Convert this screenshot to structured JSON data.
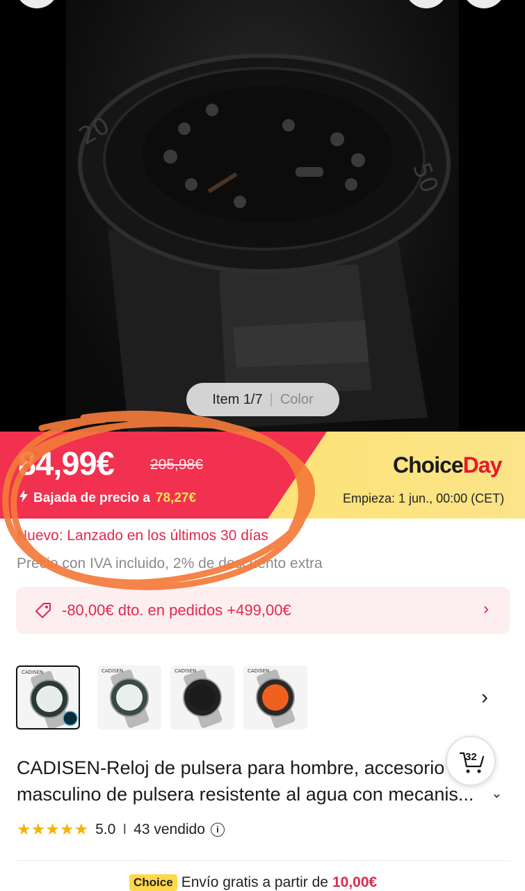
{
  "gallery": {
    "pager_index": "Item 1/7",
    "pager_separator": "|",
    "pager_color": "Color"
  },
  "price": {
    "current": "84,99€",
    "original": "205,98€",
    "drop_label": "Bajada de precio a",
    "drop_value": "78,27€"
  },
  "promo": {
    "logo_part1": "Choice",
    "logo_part2": "Day",
    "start_text": "Empieza:  1 jun., 00:00 (CET)"
  },
  "notes": {
    "new_launch": "Nuevo: Lanzado en los últimos 30 días",
    "vat": "Precio con IVA incluido, 2% de descuento extra"
  },
  "coupon": {
    "text": "-80,00€ dto. en pedidos +499,00€"
  },
  "thumbnails": [
    {
      "brand": "CADISEN",
      "dial": "#e7ecea",
      "bezel": "#2b3a33"
    },
    {
      "brand": "CADISEN",
      "dial": "#e9efec",
      "bezel": "#3a4a44"
    },
    {
      "brand": "CADISEN",
      "dial": "#1b1b1b",
      "bezel": "#222222"
    },
    {
      "brand": "CADISEN",
      "dial": "#f0611e",
      "bezel": "#2a2a2a"
    }
  ],
  "product": {
    "title_line1": "CADISEN-Reloj de pulsera para hombre, accesorio",
    "title_line2": "masculino de pulsera resistente al agua con mecanis...",
    "rating": "5.0",
    "rating_divider": "I",
    "sold": "43 vendido"
  },
  "cart": {
    "count": "32"
  },
  "shipping": {
    "badge": "Choice",
    "text": "Envío gratis a partir de",
    "amount": "10,00€"
  },
  "colors": {
    "price_red": "#f2304f",
    "accent_red": "#e0294d",
    "promo_yellow": "#fde37a",
    "annotation_orange": "#f47a3a"
  }
}
